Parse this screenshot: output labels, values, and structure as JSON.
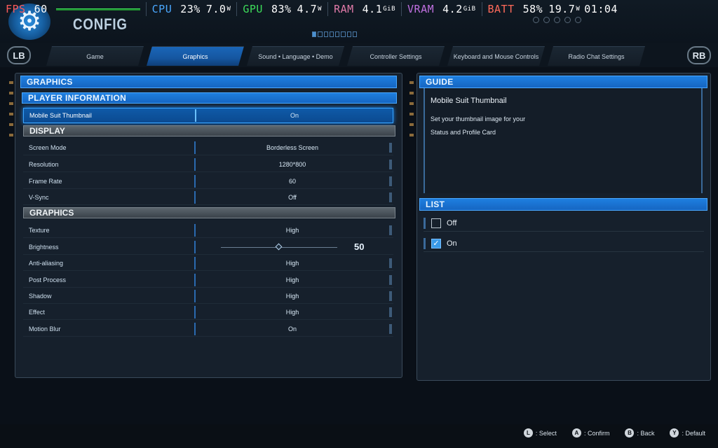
{
  "perf": {
    "fps": {
      "label": "FPS",
      "value": "60",
      "color": "#ff5a5a"
    },
    "cpu": {
      "label": "CPU",
      "value": "23%",
      "power": "7.0",
      "unit": "W",
      "color": "#4aa8ff"
    },
    "gpu": {
      "label": "GPU",
      "value": "83%",
      "power": "4.7",
      "unit": "W",
      "color": "#3ddc5a"
    },
    "ram": {
      "label": "RAM",
      "value": "4.1",
      "unit": "GiB",
      "color": "#e07aa8"
    },
    "vram": {
      "label": "VRAM",
      "value": "4.2",
      "unit": "GiB",
      "color": "#c070e0"
    },
    "batt": {
      "label": "BATT",
      "value": "58%",
      "power": "19.7",
      "unit": "W",
      "time": "01:04",
      "color": "#ff6a5a"
    }
  },
  "header": {
    "title": "CONFIG"
  },
  "tabs": {
    "lb": "LB",
    "rb": "RB",
    "items": [
      "Game",
      "Graphics",
      "Sound • Language • Demo",
      "Controller Settings",
      "Keyboard and Mouse Controls",
      "Radio Chat Settings"
    ],
    "active_index": 1
  },
  "left": {
    "header": "GRAPHICS",
    "player_info_header": "PLAYER INFORMATION",
    "thumbnail": {
      "label": "Mobile Suit Thumbnail",
      "value": "On"
    },
    "display_header": "DISPLAY",
    "display_rows": [
      {
        "label": "Screen Mode",
        "value": "Borderless Screen"
      },
      {
        "label": "Resolution",
        "value": "1280*800"
      },
      {
        "label": "Frame Rate",
        "value": "60"
      },
      {
        "label": "V-Sync",
        "value": "Off"
      }
    ],
    "graphics_header": "GRAPHICS",
    "texture": {
      "label": "Texture",
      "value": "High"
    },
    "brightness": {
      "label": "Brightness",
      "value": "50",
      "level": 0.5
    },
    "graphics_rows": [
      {
        "label": "Anti-aliasing",
        "value": "High"
      },
      {
        "label": "Post Process",
        "value": "High"
      },
      {
        "label": "Shadow",
        "value": "High"
      },
      {
        "label": "Effect",
        "value": "High"
      },
      {
        "label": "Motion Blur",
        "value": "On"
      }
    ]
  },
  "right": {
    "guide_header": "GUIDE",
    "guide_title": "Mobile Suit Thumbnail",
    "guide_line1": "Set your thumbnail image for your",
    "guide_line2": "Status and Profile Card",
    "list_header": "LIST",
    "list": [
      {
        "label": "Off",
        "checked": false
      },
      {
        "label": "On",
        "checked": true
      }
    ]
  },
  "footer": {
    "hints": [
      {
        "button": "L",
        "label": ": Select"
      },
      {
        "button": "A",
        "label": ": Confirm"
      },
      {
        "button": "B",
        "label": ": Back"
      },
      {
        "button": "Y",
        "label": ": Default"
      }
    ]
  }
}
